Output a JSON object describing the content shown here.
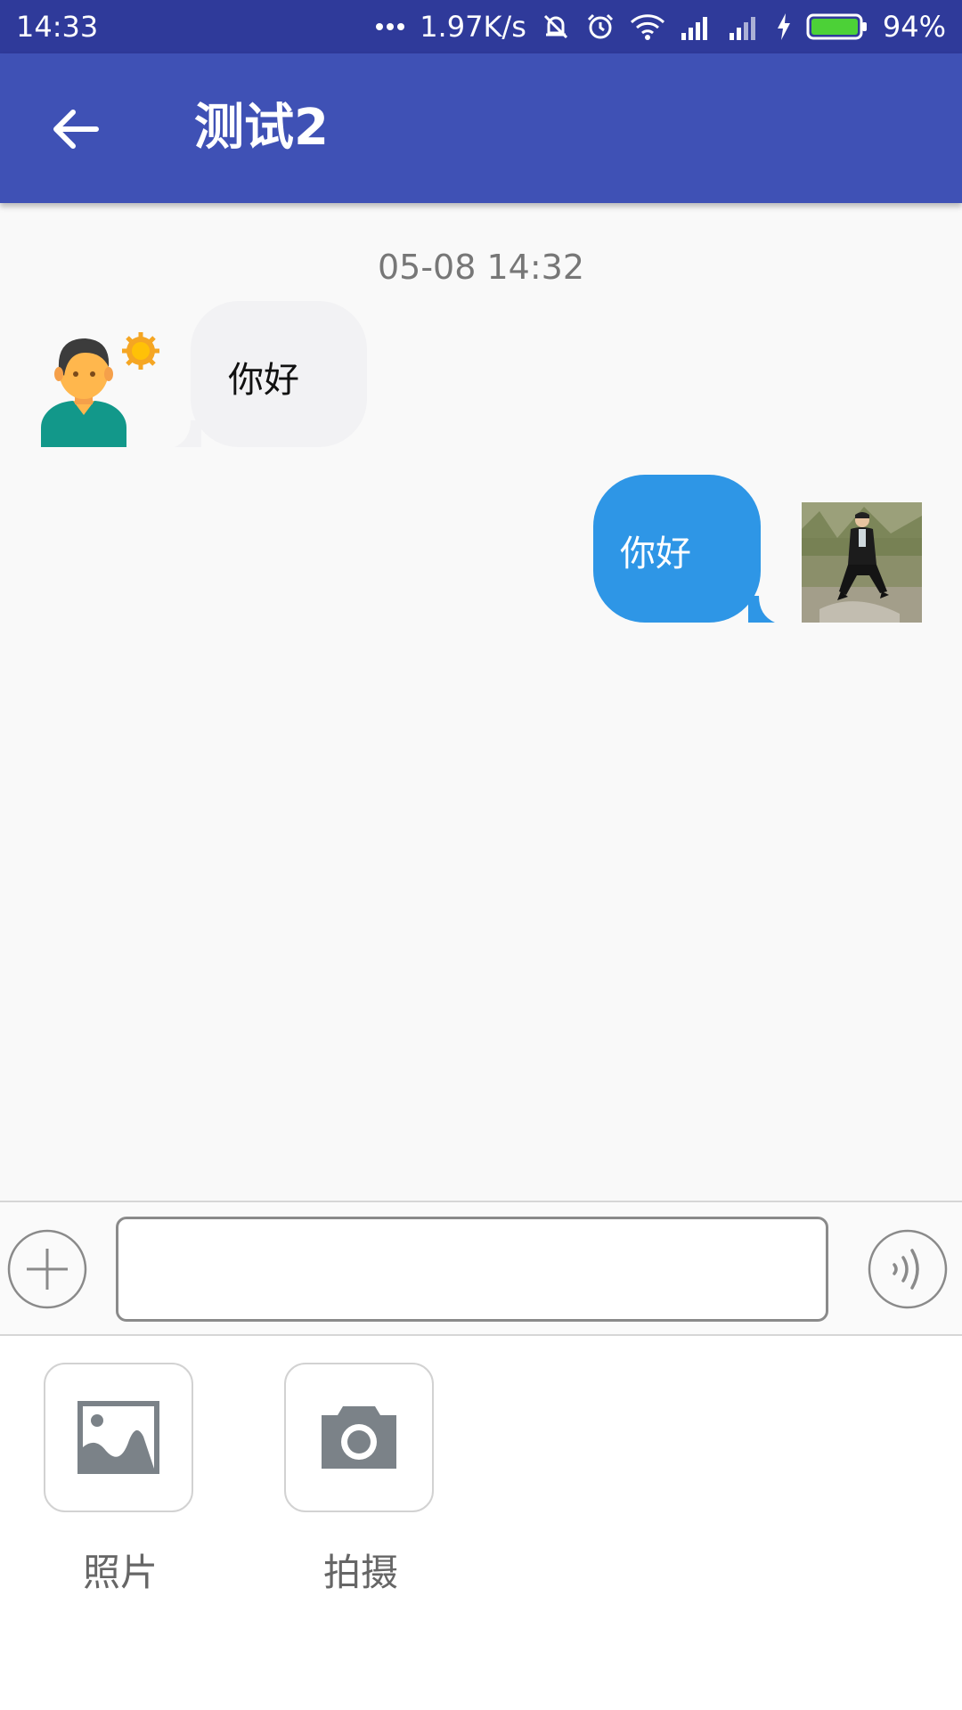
{
  "status_bar": {
    "time": "14:33",
    "network_speed": "1.97K/s",
    "battery": "94%",
    "icons": [
      "more-dots-icon",
      "mute-bell-icon",
      "alarm-icon",
      "wifi-icon",
      "signal-icon",
      "signal-icon",
      "charging-icon",
      "battery-icon"
    ]
  },
  "app_bar": {
    "title": "测试2",
    "back_icon": "arrow-left-icon"
  },
  "chat": {
    "timestamp": "05-08 14:32",
    "messages": [
      {
        "side": "left",
        "text": "你好",
        "avatar": "cartoon-person-avatar"
      },
      {
        "side": "right",
        "text": "你好",
        "avatar": "photo-avatar"
      }
    ]
  },
  "input_bar": {
    "plus_icon": "plus-circle-icon",
    "text_value": "",
    "voice_icon": "voice-wave-icon"
  },
  "attach_panel": {
    "items": [
      {
        "label": "照片",
        "icon": "image-icon"
      },
      {
        "label": "拍摄",
        "icon": "camera-icon"
      }
    ]
  },
  "colors": {
    "status_bar": "#2f3a9a",
    "app_bar": "#3f51b5",
    "bubble_left": "#f2f2f4",
    "bubble_right": "#2e96e6"
  }
}
